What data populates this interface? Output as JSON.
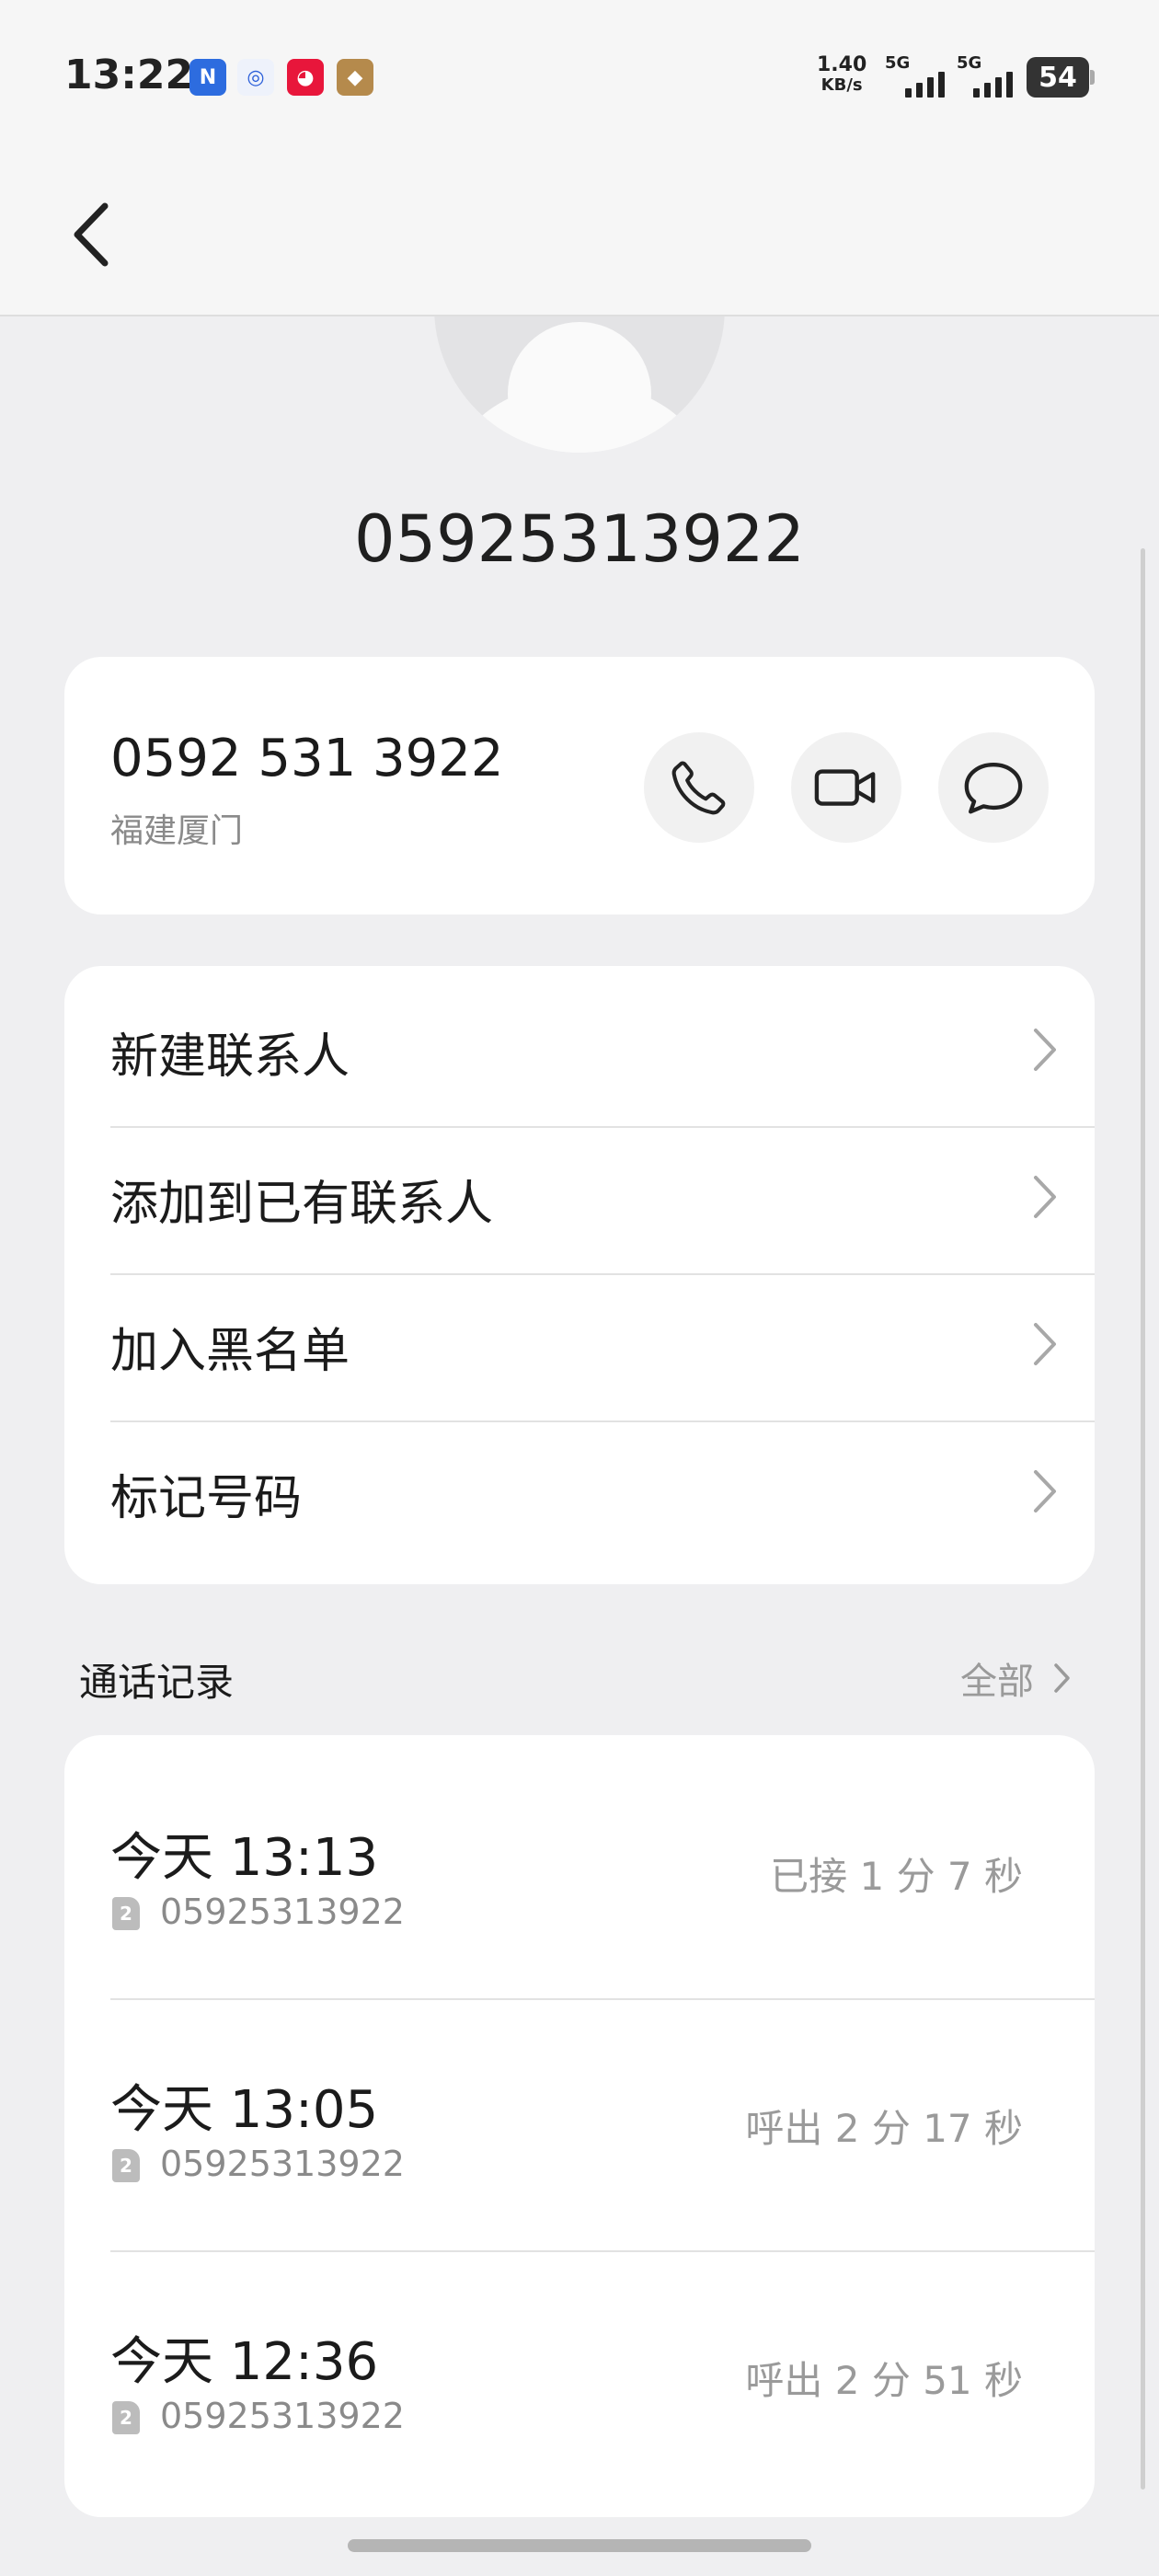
{
  "status_bar": {
    "time": "13:22",
    "net_speed_value": "1.40",
    "net_speed_unit": "KB/s",
    "sim1_label": "5G",
    "sim2_label": "5G",
    "battery": "54",
    "notification_icons": [
      "nfc-icon",
      "app-icon-1",
      "tmall-icon",
      "game-icon"
    ]
  },
  "header": {
    "back_icon": "back-arrow-icon"
  },
  "contact": {
    "title_number": "05925313922",
    "formatted_number": "0592 531 3922",
    "location": "福建厦门",
    "actions": [
      "phone-call",
      "video-call",
      "message"
    ]
  },
  "menu": {
    "items": [
      {
        "label": "新建联系人"
      },
      {
        "label": "添加到已有联系人"
      },
      {
        "label": "加入黑名单"
      },
      {
        "label": "标记号码"
      }
    ]
  },
  "call_log": {
    "title": "通话记录",
    "view_all": "全部",
    "entries": [
      {
        "time": "今天 13:13",
        "sim": "2",
        "number": "05925313922",
        "status": "已接 1 分 7 秒"
      },
      {
        "time": "今天 13:05",
        "sim": "2",
        "number": "05925313922",
        "status": "呼出 2 分 17 秒"
      },
      {
        "time": "今天 12:36",
        "sim": "2",
        "number": "05925313922",
        "status": "呼出 2 分 51 秒"
      }
    ]
  },
  "colors": {
    "background": "#efeff1",
    "card": "#ffffff",
    "secondary_text": "#8a8a8a"
  }
}
